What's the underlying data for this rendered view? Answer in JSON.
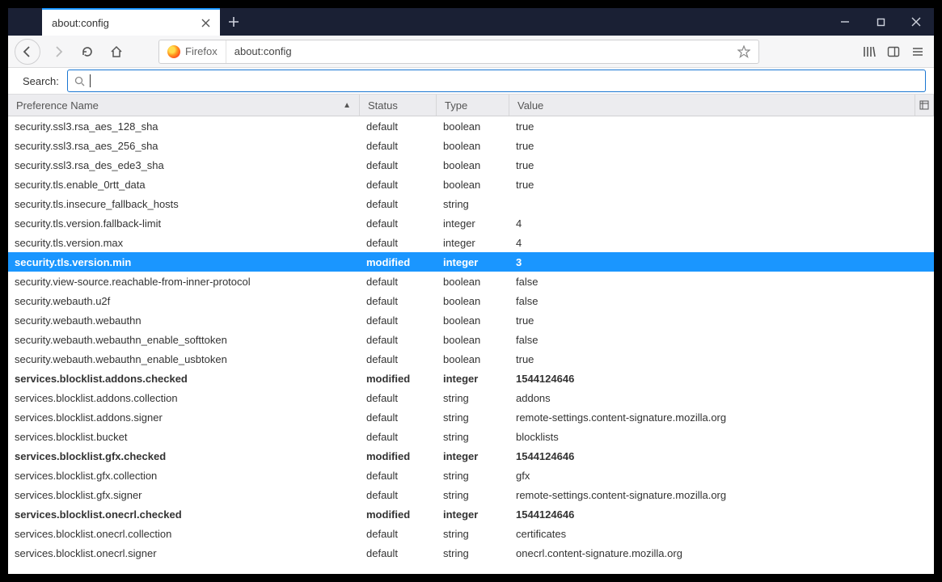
{
  "tab_title": "about:config",
  "url_chip": "Firefox",
  "url_text": "about:config",
  "filter_label": "Search:",
  "headers": {
    "name": "Preference Name",
    "status": "Status",
    "type": "Type",
    "value": "Value"
  },
  "rows": [
    {
      "name": "security.ssl3.rsa_aes_128_sha",
      "status": "default",
      "type": "boolean",
      "value": "true"
    },
    {
      "name": "security.ssl3.rsa_aes_256_sha",
      "status": "default",
      "type": "boolean",
      "value": "true"
    },
    {
      "name": "security.ssl3.rsa_des_ede3_sha",
      "status": "default",
      "type": "boolean",
      "value": "true"
    },
    {
      "name": "security.tls.enable_0rtt_data",
      "status": "default",
      "type": "boolean",
      "value": "true"
    },
    {
      "name": "security.tls.insecure_fallback_hosts",
      "status": "default",
      "type": "string",
      "value": ""
    },
    {
      "name": "security.tls.version.fallback-limit",
      "status": "default",
      "type": "integer",
      "value": "4"
    },
    {
      "name": "security.tls.version.max",
      "status": "default",
      "type": "integer",
      "value": "4"
    },
    {
      "name": "security.tls.version.min",
      "status": "modified",
      "type": "integer",
      "value": "3",
      "selected": true
    },
    {
      "name": "security.view-source.reachable-from-inner-protocol",
      "status": "default",
      "type": "boolean",
      "value": "false"
    },
    {
      "name": "security.webauth.u2f",
      "status": "default",
      "type": "boolean",
      "value": "false"
    },
    {
      "name": "security.webauth.webauthn",
      "status": "default",
      "type": "boolean",
      "value": "true"
    },
    {
      "name": "security.webauth.webauthn_enable_softtoken",
      "status": "default",
      "type": "boolean",
      "value": "false"
    },
    {
      "name": "security.webauth.webauthn_enable_usbtoken",
      "status": "default",
      "type": "boolean",
      "value": "true"
    },
    {
      "name": "services.blocklist.addons.checked",
      "status": "modified",
      "type": "integer",
      "value": "1544124646"
    },
    {
      "name": "services.blocklist.addons.collection",
      "status": "default",
      "type": "string",
      "value": "addons"
    },
    {
      "name": "services.blocklist.addons.signer",
      "status": "default",
      "type": "string",
      "value": "remote-settings.content-signature.mozilla.org"
    },
    {
      "name": "services.blocklist.bucket",
      "status": "default",
      "type": "string",
      "value": "blocklists"
    },
    {
      "name": "services.blocklist.gfx.checked",
      "status": "modified",
      "type": "integer",
      "value": "1544124646"
    },
    {
      "name": "services.blocklist.gfx.collection",
      "status": "default",
      "type": "string",
      "value": "gfx"
    },
    {
      "name": "services.blocklist.gfx.signer",
      "status": "default",
      "type": "string",
      "value": "remote-settings.content-signature.mozilla.org"
    },
    {
      "name": "services.blocklist.onecrl.checked",
      "status": "modified",
      "type": "integer",
      "value": "1544124646"
    },
    {
      "name": "services.blocklist.onecrl.collection",
      "status": "default",
      "type": "string",
      "value": "certificates"
    },
    {
      "name": "services.blocklist.onecrl.signer",
      "status": "default",
      "type": "string",
      "value": "onecrl.content-signature.mozilla.org"
    }
  ]
}
